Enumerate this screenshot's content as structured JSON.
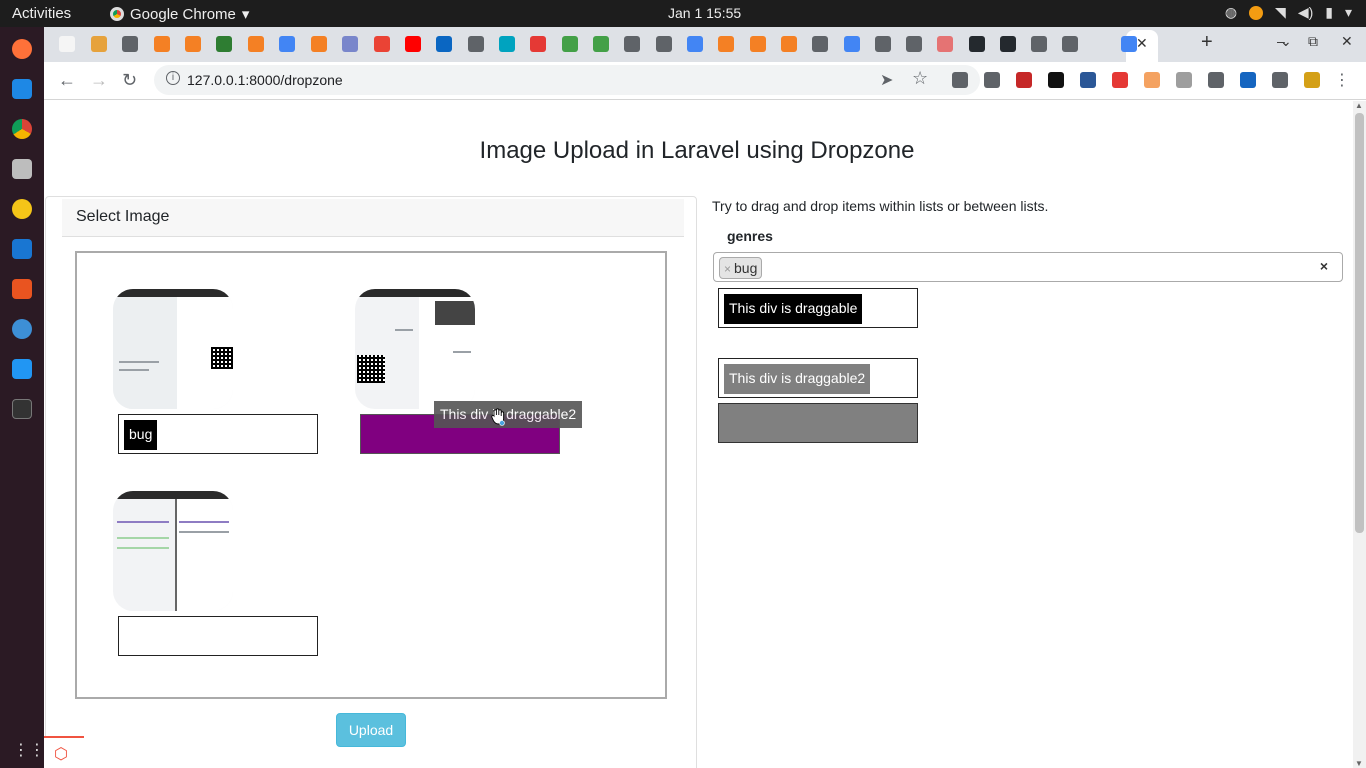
{
  "system": {
    "activities": "Activities",
    "app_name": "Google Chrome",
    "clock": "Jan 1  15:55"
  },
  "browser": {
    "url": "127.0.0.1:8000/dropzone",
    "tab_favicon_colors": [
      "#f5f5f5",
      "#e6a23c",
      "#5f6368",
      "#f48024",
      "#f48024",
      "#2e7d32",
      "#f48024",
      "#4285f4",
      "#f48024",
      "#7986cb",
      "#ea4335",
      "#ff0000",
      "#0a66c2",
      "#5f6368",
      "#00a3bf",
      "#e53935",
      "#43a047",
      "#43a047",
      "#5f6368",
      "#5f6368",
      "#4285f4",
      "#f48024",
      "#f48024",
      "#f48024",
      "#5f6368",
      "#4285f4",
      "#5f6368",
      "#5f6368",
      "#e57373",
      "#24292e",
      "#24292e",
      "#5f6368",
      "#5f6368"
    ],
    "extension_colors": [
      "#5f6368",
      "#5f6368",
      "#c62828",
      "#111111",
      "#2b5797",
      "#e53935",
      "#f4a261",
      "#9e9e9e",
      "#5f6368",
      "#1565c0",
      "#5f6368",
      "#d4a017"
    ]
  },
  "page": {
    "title": "Image Upload in Laravel using Dropzone",
    "card_header": "Select Image",
    "previews": [
      {
        "tag": "bug"
      },
      {
        "tag": ""
      },
      {
        "tag": ""
      }
    ],
    "drag_ghost_text": "This div is draggable2",
    "upload_label": "Upload",
    "hint": "Try to drag and drop items within lists or between lists.",
    "genres_label": "genres",
    "selected_genre": "bug",
    "chip_remove": "×",
    "clear_all": "×",
    "draggable_1": "This div is draggable",
    "draggable_2": "This div is draggable2",
    "colors": {
      "purple_drop": "#800080",
      "upload_btn": "#5bc0de",
      "gray_drop": "#808080",
      "draggable_1_bg": "#000000",
      "draggable_2_bg": "#808080"
    }
  }
}
